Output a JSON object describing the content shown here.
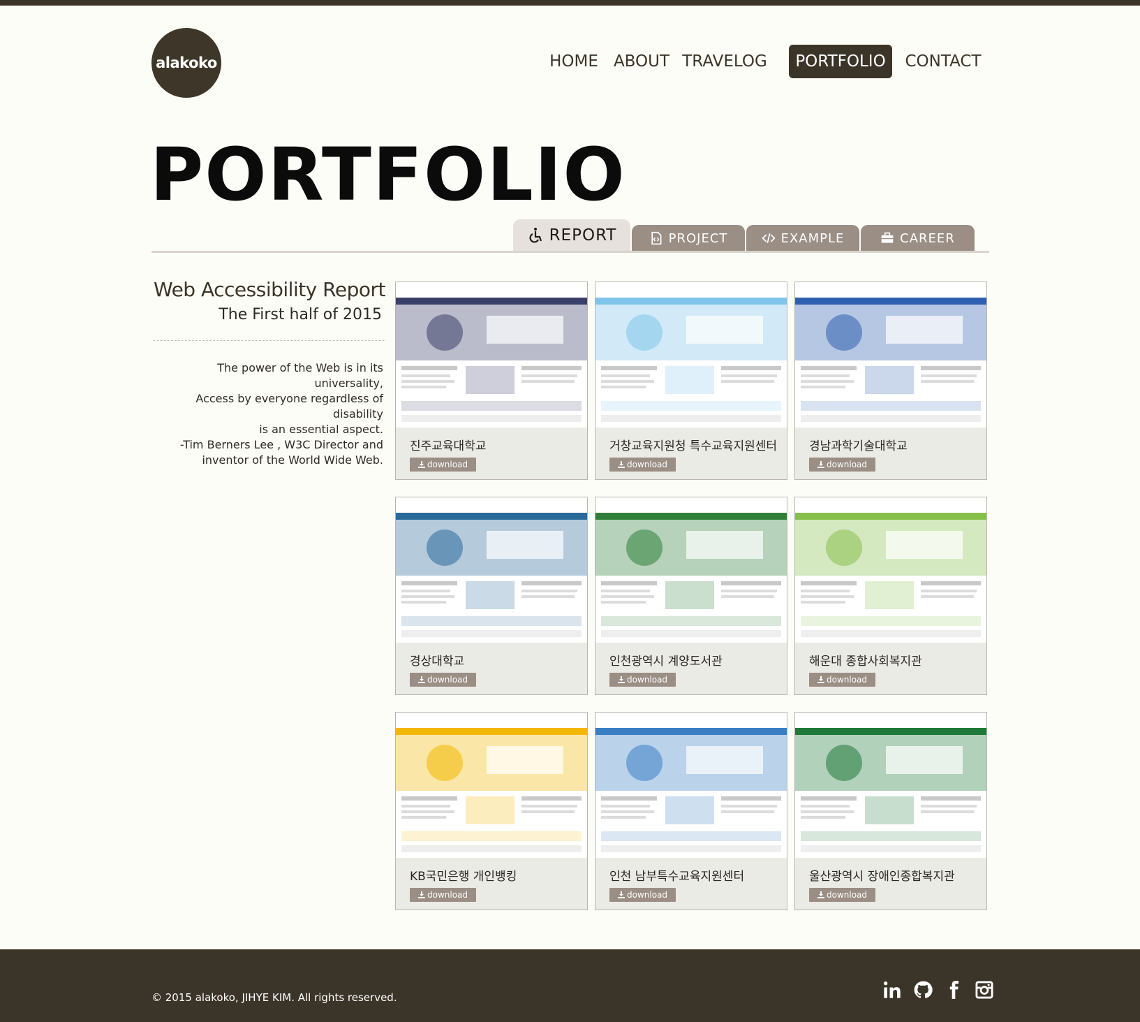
{
  "header": {
    "logo_text": "alakoko",
    "nav": [
      {
        "label": "HOME",
        "active": false
      },
      {
        "label": "ABOUT",
        "active": false
      },
      {
        "label": "TRAVELOG",
        "active": false
      },
      {
        "label": "PORTFOLIO",
        "active": true
      },
      {
        "label": "CONTACT",
        "active": false
      }
    ]
  },
  "page_title": "PORTFOLIO",
  "tabs": [
    {
      "label": "REPORT",
      "icon": "wheelchair-icon",
      "active": true
    },
    {
      "label": "PROJECT",
      "icon": "code-file-icon",
      "active": false
    },
    {
      "label": "EXAMPLE",
      "icon": "code-icon",
      "active": false
    },
    {
      "label": "CAREER",
      "icon": "briefcase-icon",
      "active": false
    }
  ],
  "sidebar": {
    "title": "Web Accessibility Report",
    "subtitle": "The First half of 2015",
    "quote_lines": [
      "The power of the Web is in its universality,",
      "Access by everyone regardless of disability",
      "is an essential aspect.",
      "-Tim Berners Lee , W3C Director and",
      "inventor of the World Wide Web."
    ]
  },
  "download_label": "download",
  "cards": [
    {
      "name": "진주교육대학교",
      "theme": "#3a3f6a"
    },
    {
      "name": "거창교육지원청 특수교육지원센터",
      "theme": "#7fc4ea"
    },
    {
      "name": "경남과학기술대학교",
      "theme": "#2f5fb0"
    },
    {
      "name": "경상대학교",
      "theme": "#2a6a9a"
    },
    {
      "name": "인천광역시 계양도서관",
      "theme": "#2f7f3a"
    },
    {
      "name": "해운대 종합사회복지관",
      "theme": "#86c04a"
    },
    {
      "name": "KB국민은행 개인뱅킹",
      "theme": "#f2b800"
    },
    {
      "name": "인천 남부특수교육지원센터",
      "theme": "#3a7fc4"
    },
    {
      "name": "울산광역시 장애인종합복지관",
      "theme": "#1f7a3a"
    }
  ],
  "footer": {
    "copyright": "© 2015 alakoko, JIHYE KIM. All rights reserved.",
    "social": [
      "linkedin-icon",
      "github-icon",
      "facebook-icon",
      "instagram-icon"
    ]
  }
}
